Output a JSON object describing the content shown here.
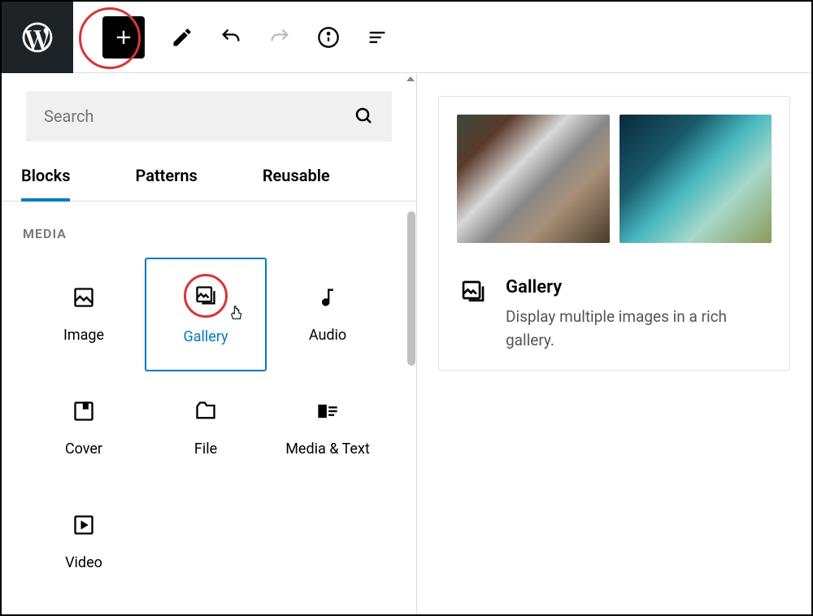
{
  "search": {
    "placeholder": "Search"
  },
  "tabs": [
    {
      "label": "Blocks",
      "active": true
    },
    {
      "label": "Patterns",
      "active": false
    },
    {
      "label": "Reusable",
      "active": false
    }
  ],
  "section": {
    "title": "MEDIA"
  },
  "blocks": [
    {
      "label": "Image",
      "icon": "image-icon",
      "selected": false
    },
    {
      "label": "Gallery",
      "icon": "gallery-icon",
      "selected": true
    },
    {
      "label": "Audio",
      "icon": "audio-icon",
      "selected": false
    },
    {
      "label": "Cover",
      "icon": "cover-icon",
      "selected": false
    },
    {
      "label": "File",
      "icon": "file-icon",
      "selected": false
    },
    {
      "label": "Media & Text",
      "icon": "media-text-icon",
      "selected": false
    },
    {
      "label": "Video",
      "icon": "video-icon",
      "selected": false
    }
  ],
  "preview": {
    "title": "Gallery",
    "description": "Display multiple images in a rich gallery."
  }
}
